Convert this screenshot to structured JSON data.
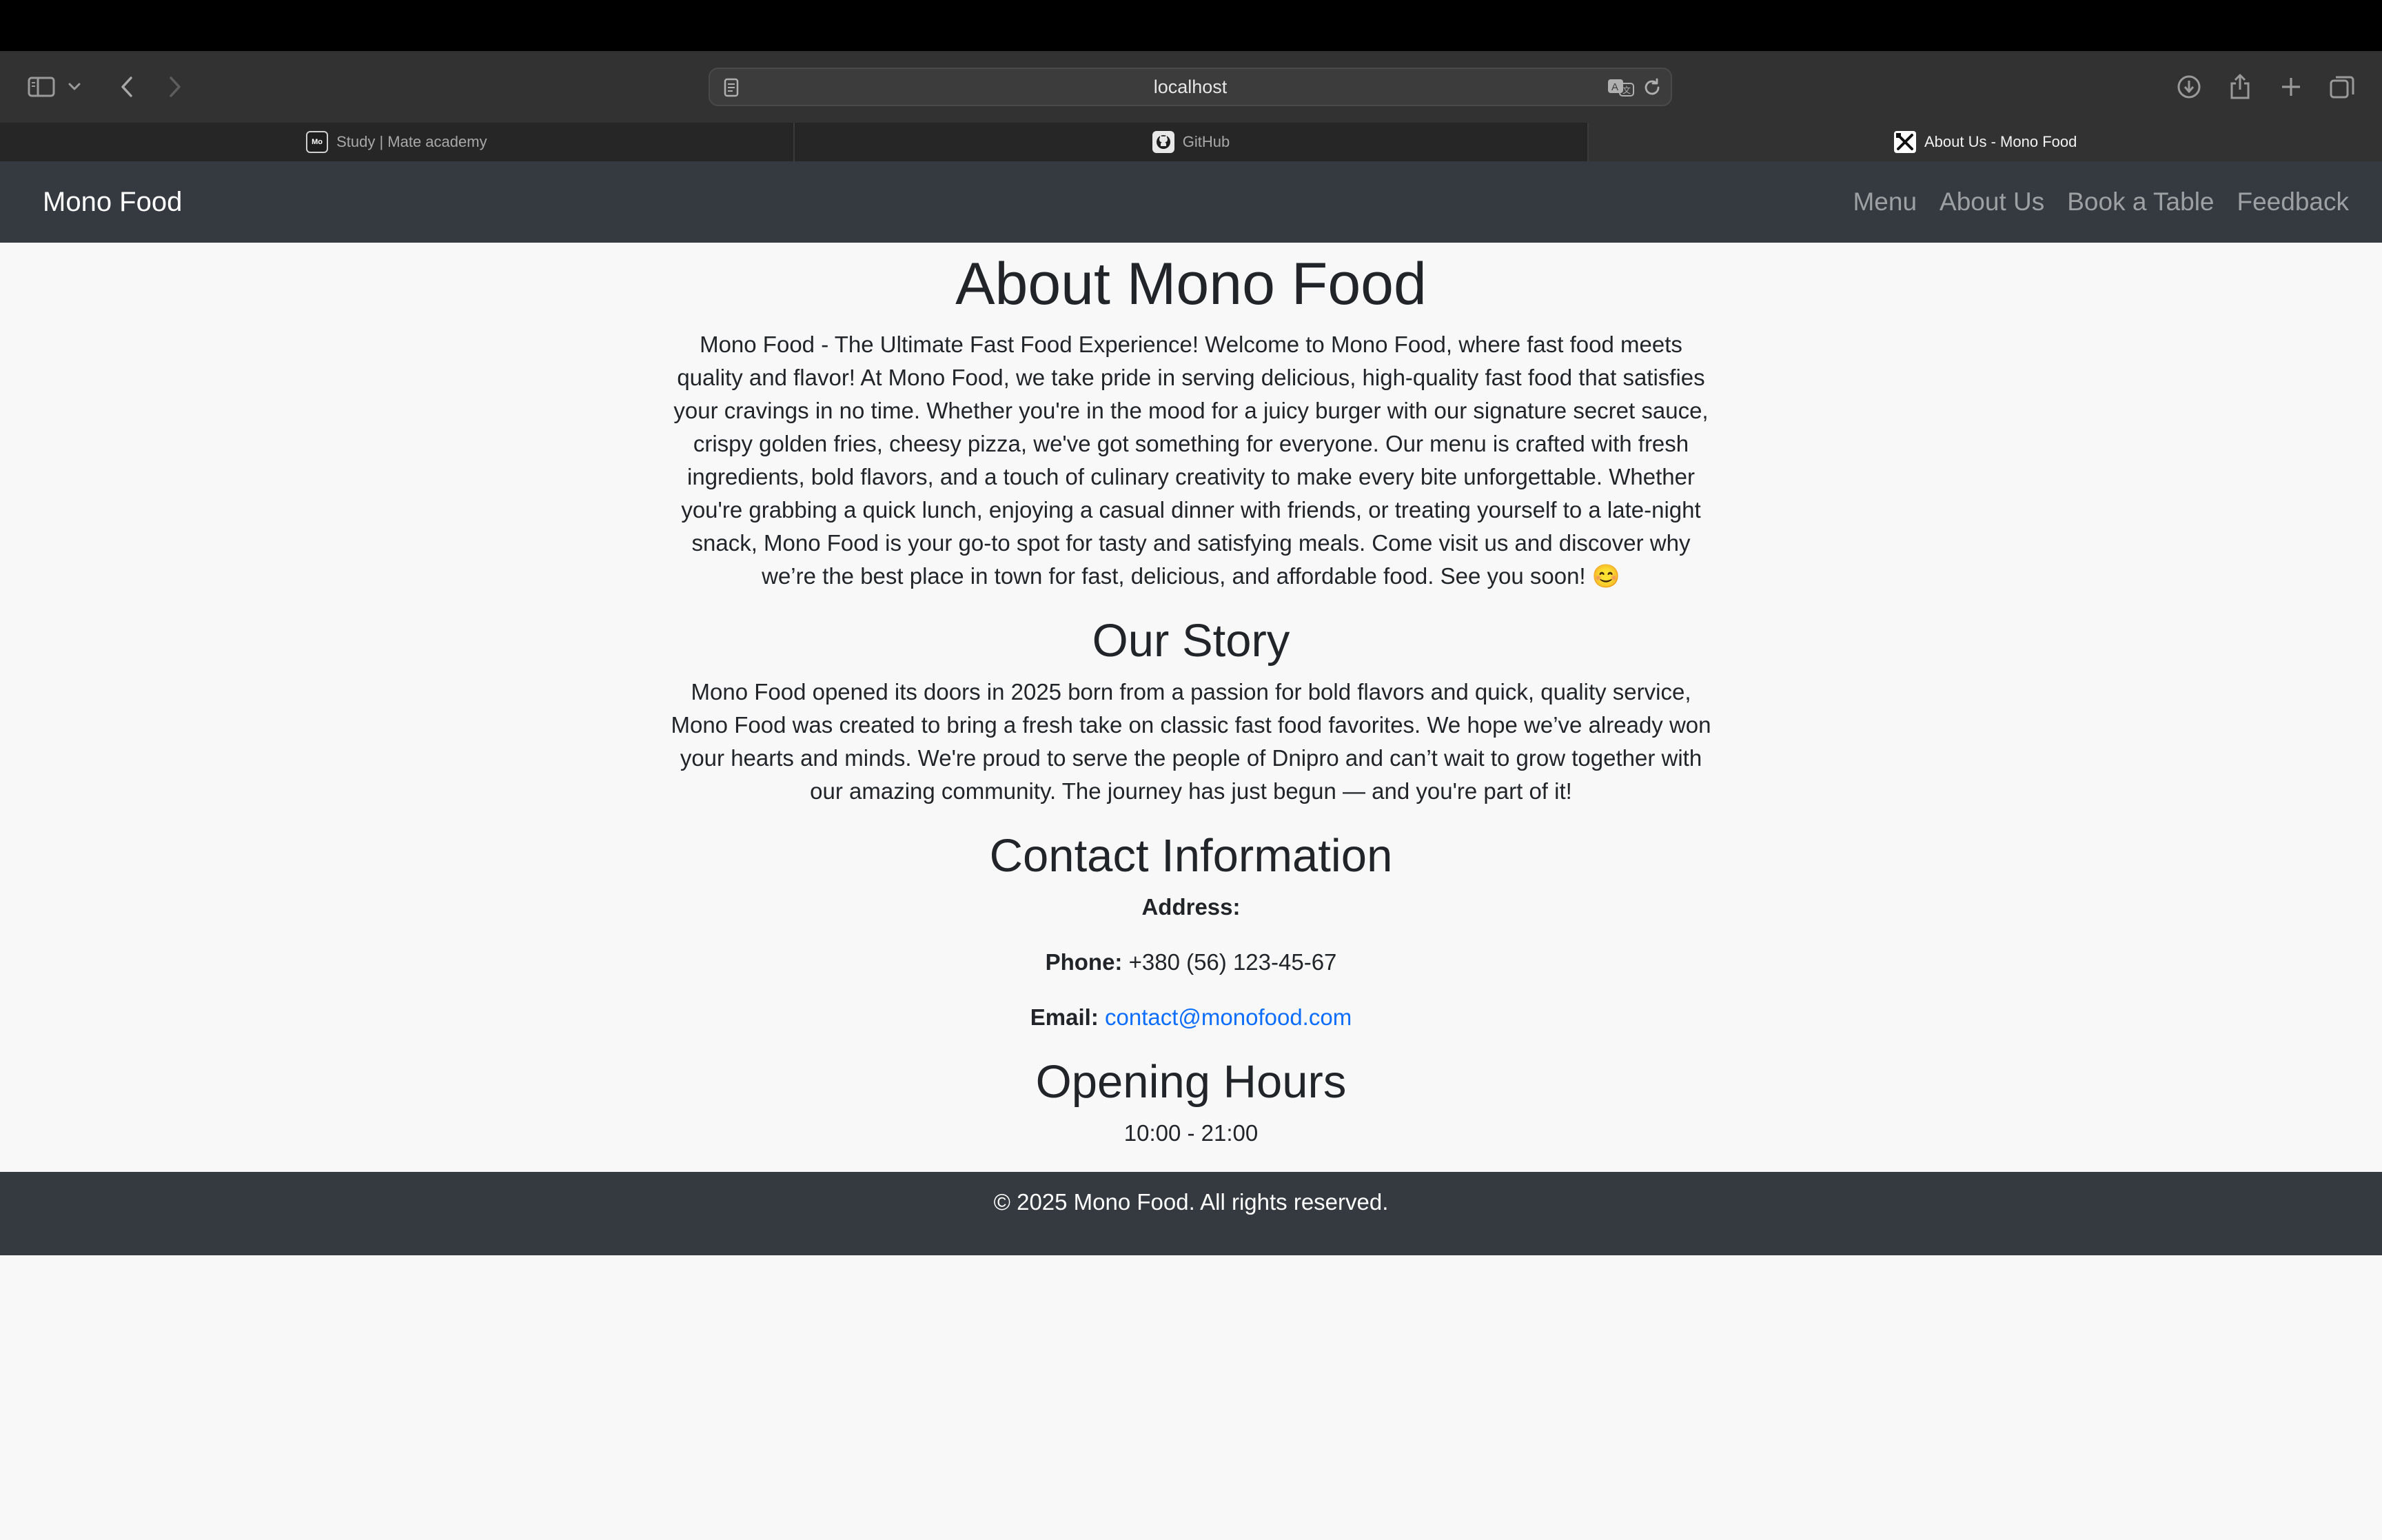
{
  "browser": {
    "url": "localhost",
    "tabs": [
      {
        "label": "Study | Mate academy",
        "favicon": "Mo",
        "active": false
      },
      {
        "label": "GitHub",
        "favicon": "github-icon",
        "active": false
      },
      {
        "label": "About Us - Mono Food",
        "favicon": "utensils-icon",
        "active": true
      }
    ],
    "icons": [
      "sidebar-icon",
      "chevron-down-icon",
      "back-icon",
      "forward-icon",
      "reader-icon",
      "translate-icon",
      "reload-icon",
      "download-icon",
      "share-icon",
      "new-tab-icon",
      "tab-overview-icon"
    ]
  },
  "site": {
    "brand": "Mono Food",
    "nav": [
      "Menu",
      "About Us",
      "Book a Table",
      "Feedback"
    ]
  },
  "about": {
    "title": "About Mono Food",
    "intro": "Mono Food - The Ultimate Fast Food Experience! Welcome to Mono Food, where fast food meets quality and flavor! At Mono Food, we take pride in serving delicious, high-quality fast food that satisfies your cravings in no time. Whether you're in the mood for a juicy burger with our signature secret sauce, crispy golden fries, cheesy pizza, we've got something for everyone. Our menu is crafted with fresh ingredients, bold flavors, and a touch of culinary creativity to make every bite unforgettable. Whether you're grabbing a quick lunch, enjoying a casual dinner with friends, or treating yourself to a late-night snack, Mono Food is your go-to spot for tasty and satisfying meals. Come visit us and discover why we’re the best place in town for fast, delicious, and affordable food. See you soon! 😊"
  },
  "story": {
    "title": "Our Story",
    "text": "Mono Food opened its doors in 2025 born from a passion for bold flavors and quick, quality service, Mono Food was created to bring a fresh take on classic fast food favorites. We hope we’ve already won your hearts and minds. We're proud to serve the people of Dnipro and can’t wait to grow together with our amazing community. The journey has just begun — and you're part of it!"
  },
  "contact": {
    "title": "Contact Information",
    "address_label": "Address:",
    "phone_label": "Phone:",
    "phone": "+380 (56) 123-45-67",
    "email_label": "Email:",
    "email": "contact@monofood.com"
  },
  "hours": {
    "title": "Opening Hours",
    "value": "10:00 - 21:00"
  },
  "footer": {
    "text": "© 2025 Mono Food. All rights reserved."
  },
  "colors": {
    "navbar": "#343a40",
    "page_bg": "#f8f8f8",
    "link": "#0d6efd",
    "nav_link": "#9ea1a4"
  }
}
